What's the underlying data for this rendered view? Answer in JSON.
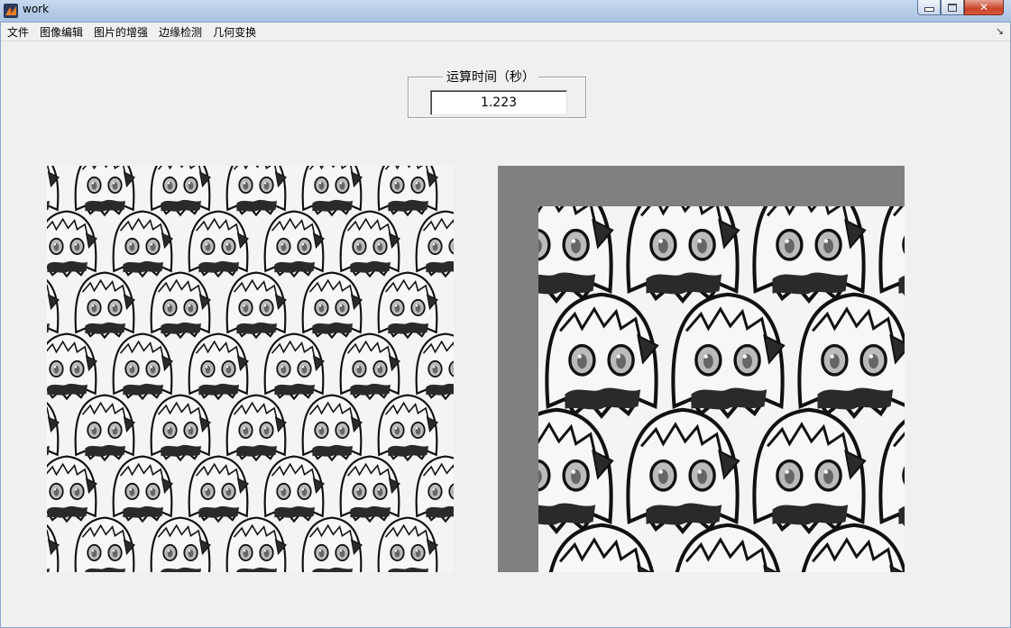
{
  "window": {
    "title": "work"
  },
  "menu": {
    "items": [
      "文件",
      "图像编辑",
      "图片的增强",
      "边缘检测",
      "几何变换"
    ]
  },
  "time_panel": {
    "title": "运算时间（秒）",
    "value": "1.223"
  },
  "colors": {
    "background": "#f0f0f0",
    "padding_gray": "#808080",
    "ink": "#111111",
    "dark_shadow": "#2a2a2a"
  },
  "images": {
    "left": "original-pattern-image",
    "right": "translated-zoomed-pattern-image"
  }
}
